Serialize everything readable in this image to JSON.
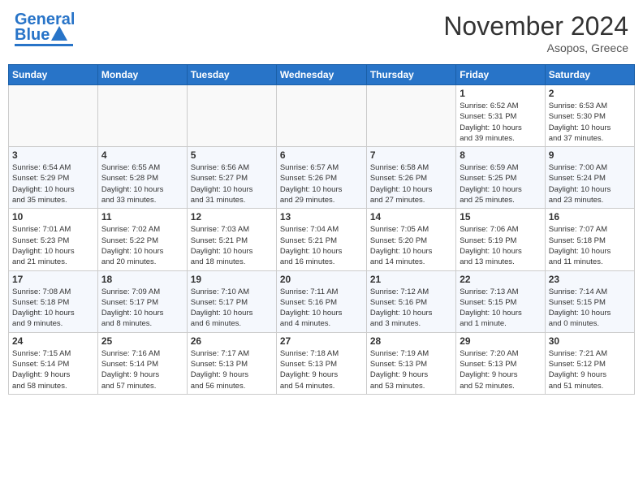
{
  "header": {
    "logo_line1": "General",
    "logo_line2": "Blue",
    "title": "November 2024",
    "subtitle": "Asopos, Greece"
  },
  "days_of_week": [
    "Sunday",
    "Monday",
    "Tuesday",
    "Wednesday",
    "Thursday",
    "Friday",
    "Saturday"
  ],
  "weeks": [
    [
      {
        "day": "",
        "info": ""
      },
      {
        "day": "",
        "info": ""
      },
      {
        "day": "",
        "info": ""
      },
      {
        "day": "",
        "info": ""
      },
      {
        "day": "",
        "info": ""
      },
      {
        "day": "1",
        "info": "Sunrise: 6:52 AM\nSunset: 5:31 PM\nDaylight: 10 hours\nand 39 minutes."
      },
      {
        "day": "2",
        "info": "Sunrise: 6:53 AM\nSunset: 5:30 PM\nDaylight: 10 hours\nand 37 minutes."
      }
    ],
    [
      {
        "day": "3",
        "info": "Sunrise: 6:54 AM\nSunset: 5:29 PM\nDaylight: 10 hours\nand 35 minutes."
      },
      {
        "day": "4",
        "info": "Sunrise: 6:55 AM\nSunset: 5:28 PM\nDaylight: 10 hours\nand 33 minutes."
      },
      {
        "day": "5",
        "info": "Sunrise: 6:56 AM\nSunset: 5:27 PM\nDaylight: 10 hours\nand 31 minutes."
      },
      {
        "day": "6",
        "info": "Sunrise: 6:57 AM\nSunset: 5:26 PM\nDaylight: 10 hours\nand 29 minutes."
      },
      {
        "day": "7",
        "info": "Sunrise: 6:58 AM\nSunset: 5:26 PM\nDaylight: 10 hours\nand 27 minutes."
      },
      {
        "day": "8",
        "info": "Sunrise: 6:59 AM\nSunset: 5:25 PM\nDaylight: 10 hours\nand 25 minutes."
      },
      {
        "day": "9",
        "info": "Sunrise: 7:00 AM\nSunset: 5:24 PM\nDaylight: 10 hours\nand 23 minutes."
      }
    ],
    [
      {
        "day": "10",
        "info": "Sunrise: 7:01 AM\nSunset: 5:23 PM\nDaylight: 10 hours\nand 21 minutes."
      },
      {
        "day": "11",
        "info": "Sunrise: 7:02 AM\nSunset: 5:22 PM\nDaylight: 10 hours\nand 20 minutes."
      },
      {
        "day": "12",
        "info": "Sunrise: 7:03 AM\nSunset: 5:21 PM\nDaylight: 10 hours\nand 18 minutes."
      },
      {
        "day": "13",
        "info": "Sunrise: 7:04 AM\nSunset: 5:21 PM\nDaylight: 10 hours\nand 16 minutes."
      },
      {
        "day": "14",
        "info": "Sunrise: 7:05 AM\nSunset: 5:20 PM\nDaylight: 10 hours\nand 14 minutes."
      },
      {
        "day": "15",
        "info": "Sunrise: 7:06 AM\nSunset: 5:19 PM\nDaylight: 10 hours\nand 13 minutes."
      },
      {
        "day": "16",
        "info": "Sunrise: 7:07 AM\nSunset: 5:18 PM\nDaylight: 10 hours\nand 11 minutes."
      }
    ],
    [
      {
        "day": "17",
        "info": "Sunrise: 7:08 AM\nSunset: 5:18 PM\nDaylight: 10 hours\nand 9 minutes."
      },
      {
        "day": "18",
        "info": "Sunrise: 7:09 AM\nSunset: 5:17 PM\nDaylight: 10 hours\nand 8 minutes."
      },
      {
        "day": "19",
        "info": "Sunrise: 7:10 AM\nSunset: 5:17 PM\nDaylight: 10 hours\nand 6 minutes."
      },
      {
        "day": "20",
        "info": "Sunrise: 7:11 AM\nSunset: 5:16 PM\nDaylight: 10 hours\nand 4 minutes."
      },
      {
        "day": "21",
        "info": "Sunrise: 7:12 AM\nSunset: 5:16 PM\nDaylight: 10 hours\nand 3 minutes."
      },
      {
        "day": "22",
        "info": "Sunrise: 7:13 AM\nSunset: 5:15 PM\nDaylight: 10 hours\nand 1 minute."
      },
      {
        "day": "23",
        "info": "Sunrise: 7:14 AM\nSunset: 5:15 PM\nDaylight: 10 hours\nand 0 minutes."
      }
    ],
    [
      {
        "day": "24",
        "info": "Sunrise: 7:15 AM\nSunset: 5:14 PM\nDaylight: 9 hours\nand 58 minutes."
      },
      {
        "day": "25",
        "info": "Sunrise: 7:16 AM\nSunset: 5:14 PM\nDaylight: 9 hours\nand 57 minutes."
      },
      {
        "day": "26",
        "info": "Sunrise: 7:17 AM\nSunset: 5:13 PM\nDaylight: 9 hours\nand 56 minutes."
      },
      {
        "day": "27",
        "info": "Sunrise: 7:18 AM\nSunset: 5:13 PM\nDaylight: 9 hours\nand 54 minutes."
      },
      {
        "day": "28",
        "info": "Sunrise: 7:19 AM\nSunset: 5:13 PM\nDaylight: 9 hours\nand 53 minutes."
      },
      {
        "day": "29",
        "info": "Sunrise: 7:20 AM\nSunset: 5:13 PM\nDaylight: 9 hours\nand 52 minutes."
      },
      {
        "day": "30",
        "info": "Sunrise: 7:21 AM\nSunset: 5:12 PM\nDaylight: 9 hours\nand 51 minutes."
      }
    ]
  ]
}
